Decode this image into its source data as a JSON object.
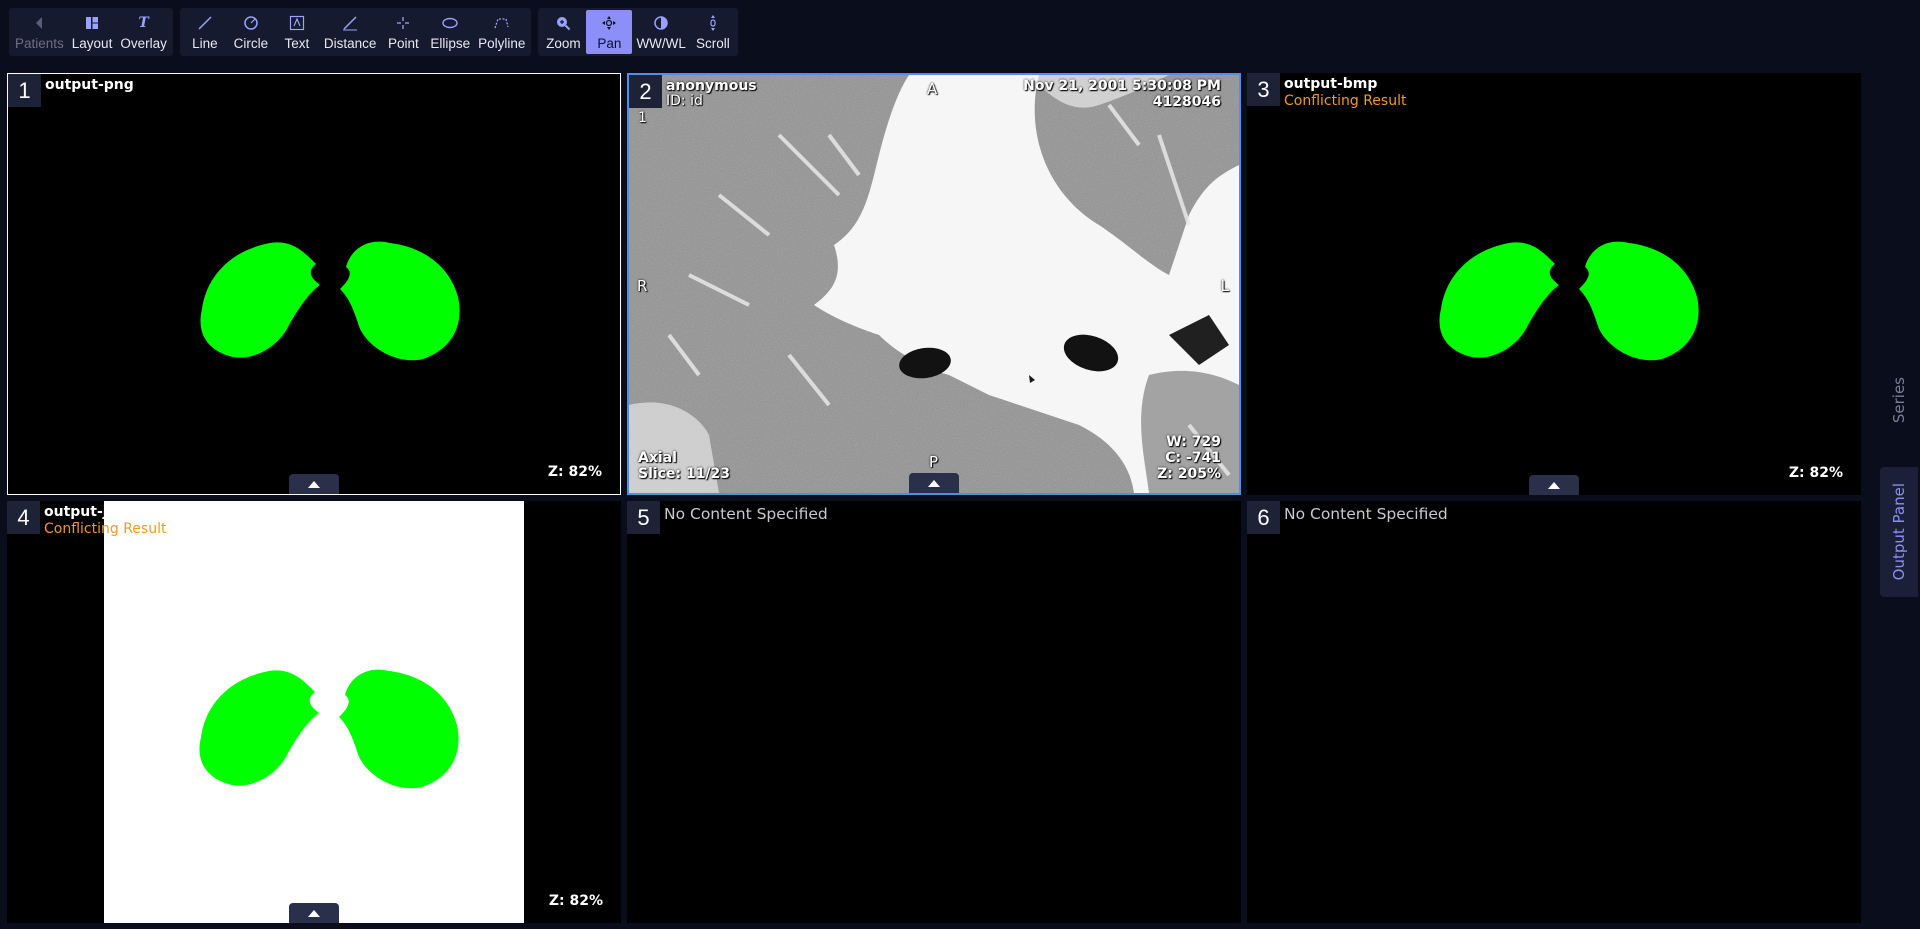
{
  "toolbar": {
    "groups": [
      [
        {
          "label": "Patients",
          "icon": "chevron-left-icon",
          "state": "disabled"
        },
        {
          "label": "Layout",
          "icon": "layout-grid-icon"
        },
        {
          "label": "Overlay",
          "icon": "italic-t-icon"
        }
      ],
      [
        {
          "label": "Line",
          "icon": "line-icon"
        },
        {
          "label": "Circle",
          "icon": "circle-icon"
        },
        {
          "label": "Text",
          "icon": "text-box-icon"
        },
        {
          "label": "Distance",
          "icon": "ruler-icon"
        },
        {
          "label": "Point",
          "icon": "crosshair-icon"
        },
        {
          "label": "Ellipse",
          "icon": "ellipse-icon"
        },
        {
          "label": "Polyline",
          "icon": "polyline-icon"
        }
      ],
      [
        {
          "label": "Zoom",
          "icon": "zoom-icon"
        },
        {
          "label": "Pan",
          "icon": "pan-icon",
          "state": "active"
        },
        {
          "label": "WW/WL",
          "icon": "contrast-icon"
        },
        {
          "label": "Scroll",
          "icon": "scroll-icon"
        }
      ]
    ]
  },
  "viewports": {
    "v1": {
      "number": "1",
      "title": "output-png",
      "zoom": "Z: 82%"
    },
    "v2": {
      "number": "2",
      "patient_name": "anonymous",
      "patient_id": "ID: id",
      "series_number": "1",
      "date": "Nov 21, 2001 5:30:08 PM",
      "accession": "4128046",
      "orient_top": "A",
      "orient_bottom": "P",
      "orient_left": "R",
      "orient_right": "L",
      "plane": "Axial",
      "slice": "Slice: 11/23",
      "ww": "W: 729",
      "wl": "C: -741",
      "zoom": "Z: 205%"
    },
    "v3": {
      "number": "3",
      "title": "output-bmp",
      "warning": "Conflicting Result",
      "zoom": "Z: 82%"
    },
    "v4": {
      "number": "4",
      "title": "output-jpeg",
      "warning": "Conflicting Result",
      "zoom": "Z: 82%"
    },
    "v5": {
      "number": "5",
      "message": "No Content Specified"
    },
    "v6": {
      "number": "6",
      "message": "No Content Specified"
    }
  },
  "side_panel": {
    "series_label": "Series",
    "output_label": "Output Panel"
  },
  "colors": {
    "accent": "#8b8ff7",
    "active_border": "#4f8fe8",
    "segmentation": "#00ff00",
    "warning": "#ef9a22"
  }
}
